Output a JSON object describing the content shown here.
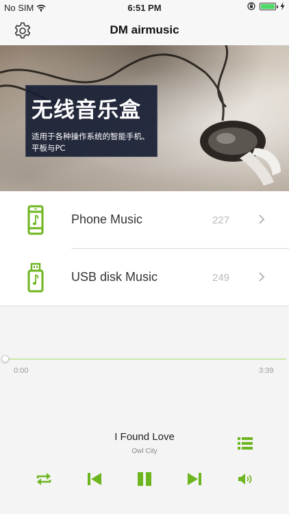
{
  "status_bar": {
    "carrier": "No SIM",
    "time": "6:51 PM"
  },
  "nav": {
    "title": "DM airmusic",
    "left_icon": "gear-icon"
  },
  "banner": {
    "headline": "无线音乐盒",
    "line1": "适用于各种操作系统的智能手机、",
    "line2": "平板与PC"
  },
  "sources": [
    {
      "label": "Phone Music",
      "count": "227",
      "icon": "phone-music-icon"
    },
    {
      "label": "USB disk Music",
      "count": "249",
      "icon": "usb-disk-icon"
    }
  ],
  "player": {
    "elapsed": "0:00",
    "total": "3:39",
    "progress": 0.0,
    "song_title": "I Found Love",
    "artist": "Owl City"
  },
  "colors": {
    "accent": "#6db51e",
    "track": "#c8e6a6",
    "background": "#f4f4f4"
  }
}
